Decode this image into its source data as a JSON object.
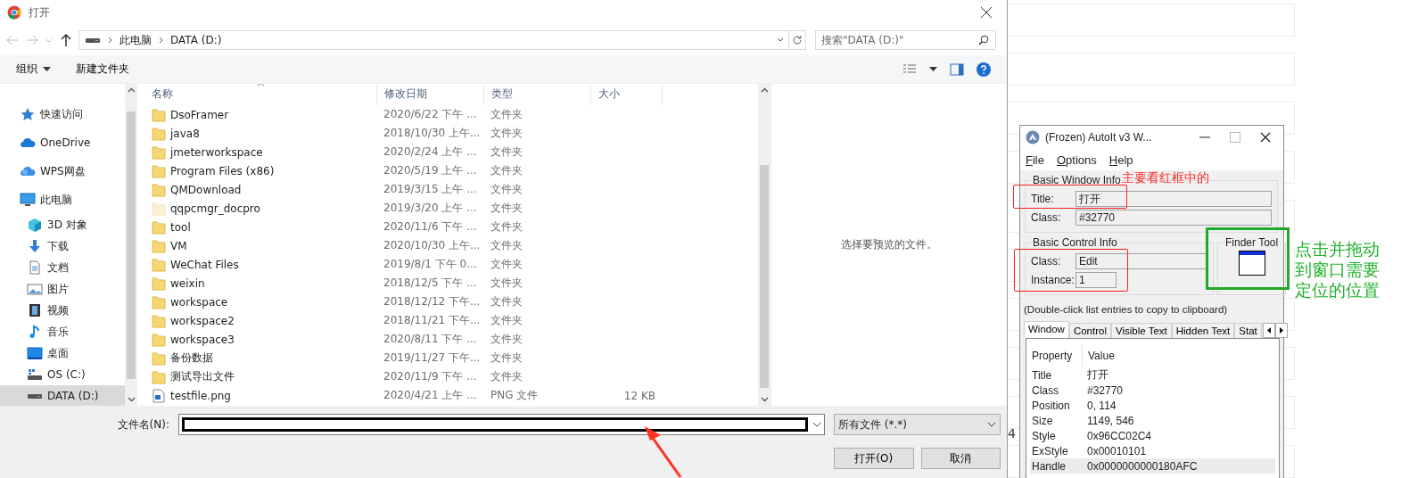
{
  "dialog": {
    "title": "打开",
    "breadcrumb": [
      "此电脑",
      "DATA (D:)"
    ],
    "search": {
      "placeholder": "搜索\"DATA (D:)\""
    },
    "toolbar": [
      {
        "label": "组织",
        "kind": "menu"
      },
      {
        "label": "新建文件夹",
        "kind": "plain"
      }
    ],
    "nav_pane": [
      {
        "label": "快速访问",
        "kind": "star",
        "selected": false
      },
      {
        "label": "OneDrive",
        "kind": "cloud",
        "selected": false
      },
      {
        "label": "WPS网盘",
        "kind": "cloud2",
        "selected": false
      },
      {
        "label": "此电脑",
        "kind": "monitor",
        "selected": false,
        "children": [
          {
            "label": "3D 对象",
            "kind": "cube",
            "selected": false
          },
          {
            "label": "下载",
            "kind": "download",
            "selected": false
          },
          {
            "label": "文档",
            "kind": "document",
            "selected": false
          },
          {
            "label": "图片",
            "kind": "picture",
            "selected": false
          },
          {
            "label": "视频",
            "kind": "film",
            "selected": false
          },
          {
            "label": "音乐",
            "kind": "music",
            "selected": false
          },
          {
            "label": "桌面",
            "kind": "desktop",
            "selected": false
          },
          {
            "label": "OS (C:)",
            "kind": "osdrive",
            "selected": false
          },
          {
            "label": "DATA (D:)",
            "kind": "drive",
            "selected": true
          }
        ]
      }
    ],
    "columns": [
      "名称",
      "修改日期",
      "类型",
      "大小"
    ],
    "files": [
      {
        "name": "DsoFramer",
        "date": "2020/6/22 下午 ...",
        "type": "文件夹",
        "kind": "folder"
      },
      {
        "name": "java8",
        "date": "2018/10/30 上午...",
        "type": "文件夹",
        "kind": "folder"
      },
      {
        "name": "jmeterworkspace",
        "date": "2020/2/24 上午 ...",
        "type": "文件夹",
        "kind": "folder"
      },
      {
        "name": "Program Files (x86)",
        "date": "2020/5/19 上午 ...",
        "type": "文件夹",
        "kind": "folder"
      },
      {
        "name": "QMDownload",
        "date": "2019/3/15 上午 ...",
        "type": "文件夹",
        "kind": "folder"
      },
      {
        "name": "qqpcmgr_docpro",
        "date": "2019/3/20 上午 ...",
        "type": "文件夹",
        "kind": "hidden-folder"
      },
      {
        "name": "tool",
        "date": "2020/11/6 下午 ...",
        "type": "文件夹",
        "kind": "folder"
      },
      {
        "name": "VM",
        "date": "2020/10/30 上午...",
        "type": "文件夹",
        "kind": "folder"
      },
      {
        "name": "WeChat Files",
        "date": "2019/8/1 下午 0...",
        "type": "文件夹",
        "kind": "folder"
      },
      {
        "name": "weixin",
        "date": "2018/12/5 下午 ...",
        "type": "文件夹",
        "kind": "folder"
      },
      {
        "name": "workspace",
        "date": "2018/12/12 下午...",
        "type": "文件夹",
        "kind": "folder"
      },
      {
        "name": "workspace2",
        "date": "2018/11/21 下午...",
        "type": "文件夹",
        "kind": "folder"
      },
      {
        "name": "workspace3",
        "date": "2020/8/11 下午 ...",
        "type": "文件夹",
        "kind": "folder"
      },
      {
        "name": "备份数据",
        "date": "2019/11/27 下午...",
        "type": "文件夹",
        "kind": "folder"
      },
      {
        "name": "测试导出文件",
        "date": "2020/11/9 下午 ...",
        "type": "文件夹",
        "kind": "folder"
      },
      {
        "name": "testfile.png",
        "date": "2020/4/21 上午 ...",
        "type": "PNG 文件",
        "size": "12 KB",
        "kind": "image"
      }
    ],
    "preview_text": "选择要预览的文件。",
    "filename_label": "文件名(N):",
    "filter": "所有文件 (*.*)",
    "buttons": [
      "打开(O)",
      "取消"
    ]
  },
  "background_text": "4",
  "autoit": {
    "title": "(Frozen) AutoIt v3 W...",
    "menu": [
      "File",
      "Options",
      "Help"
    ],
    "window_info": {
      "legend": "Basic Window Info",
      "fields": [
        {
          "label": "Title:",
          "value": "打开"
        },
        {
          "label": "Class:",
          "value": "#32770"
        }
      ]
    },
    "control_info": {
      "legend": "Basic Control Info",
      "fields": [
        {
          "label": "Class:",
          "value": "Edit"
        },
        {
          "label": "Instance:",
          "value": "1"
        }
      ]
    },
    "finder_tool": "Finder Tool",
    "hint": "(Double-click list entries to copy to clipboard)",
    "tabs": [
      {
        "label": "Window",
        "selected": true
      },
      {
        "label": "Control",
        "selected": false
      },
      {
        "label": "Visible Text",
        "selected": false
      },
      {
        "label": "Hidden Text",
        "selected": false
      },
      {
        "label": "Stat",
        "selected": false
      }
    ],
    "table": {
      "columns": [
        "Property",
        "Value"
      ],
      "rows": [
        {
          "property": "Title",
          "value": "打开",
          "selected": false
        },
        {
          "property": "Class",
          "value": "#32770",
          "selected": false
        },
        {
          "property": "Position",
          "value": "0, 114",
          "selected": false
        },
        {
          "property": "Size",
          "value": "1149, 546",
          "selected": false
        },
        {
          "property": "Style",
          "value": "0x96CC02C4",
          "selected": false
        },
        {
          "property": "ExStyle",
          "value": "0x00010101",
          "selected": false
        },
        {
          "property": "Handle",
          "value": "0x0000000000180AFC",
          "selected": true
        }
      ]
    }
  },
  "annotations": {
    "red_note": "主要看红框中的",
    "green_note": "点击并拖动到窗口需要定位的位置"
  }
}
